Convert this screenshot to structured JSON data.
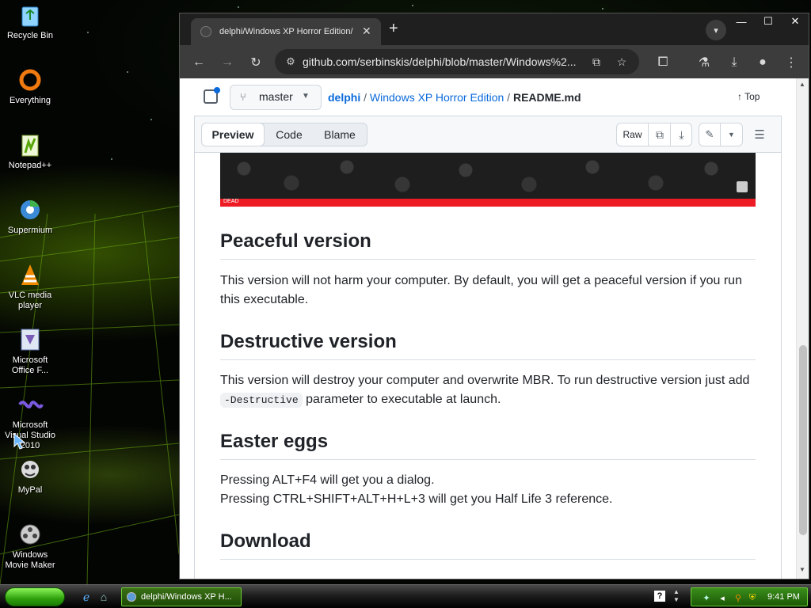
{
  "desktop": {
    "icons": [
      {
        "label": "Recycle Bin",
        "icon": "recycle-bin-icon"
      },
      {
        "label": "Everything",
        "icon": "everything-icon"
      },
      {
        "label": "Notepad++",
        "icon": "notepad-plus-plus-icon"
      },
      {
        "label": "Supermium",
        "icon": "supermium-icon"
      },
      {
        "label": "VLC media player",
        "icon": "vlc-icon"
      },
      {
        "label": "Microsoft Office F...",
        "icon": "office-icon"
      },
      {
        "label": "Microsoft Visual Studio 2010",
        "icon": "visual-studio-icon"
      },
      {
        "label": "MyPal",
        "icon": "mypal-icon"
      },
      {
        "label": "Windows Movie Maker",
        "icon": "movie-maker-icon"
      }
    ]
  },
  "browser": {
    "tab_title": "delphi/Windows XP Horror Edition/",
    "tab_close": "✕",
    "new_tab": "+",
    "window_controls": {
      "minimize": "—",
      "maximize": "☐",
      "close": "✕"
    },
    "url": "github.com/serbinskis/delphi/blob/master/Windows%2..."
  },
  "github": {
    "branch": "master",
    "breadcrumb": {
      "owner": "delphi",
      "sep": "/",
      "folder": "Windows XP Horror Edition",
      "file": "README.md"
    },
    "top_link": "Top",
    "tabs": [
      "Preview",
      "Code",
      "Blame"
    ],
    "raw_label": "Raw"
  },
  "banner": {
    "label": "DEAD"
  },
  "readme": {
    "h_peaceful": "Peaceful version",
    "p_peaceful": "This version will not harm your computer. By default, you will get a peaceful version if you run this executable.",
    "h_destructive": "Destructive version",
    "p_destructive_1": "This version will destroy your computer and overwrite MBR. To run destructive version just add",
    "p_destructive_code": "-Destructive",
    "p_destructive_2": " parameter to executable at launch.",
    "h_easter": "Easter eggs",
    "p_easter_1": "Pressing ALT+F4 will get you a dialog.",
    "p_easter_2": "Pressing CTRL+SHIFT+ALT+H+L+3 will get you Half Life 3 reference.",
    "h_download": "Download"
  },
  "taskbar": {
    "task_label": "delphi/Windows XP H...",
    "clock": "9:41 PM",
    "help": "?"
  },
  "colors": {
    "link": "#0969da",
    "banner_red": "#ed1c24",
    "taskbar_green": "#2fa10c"
  }
}
